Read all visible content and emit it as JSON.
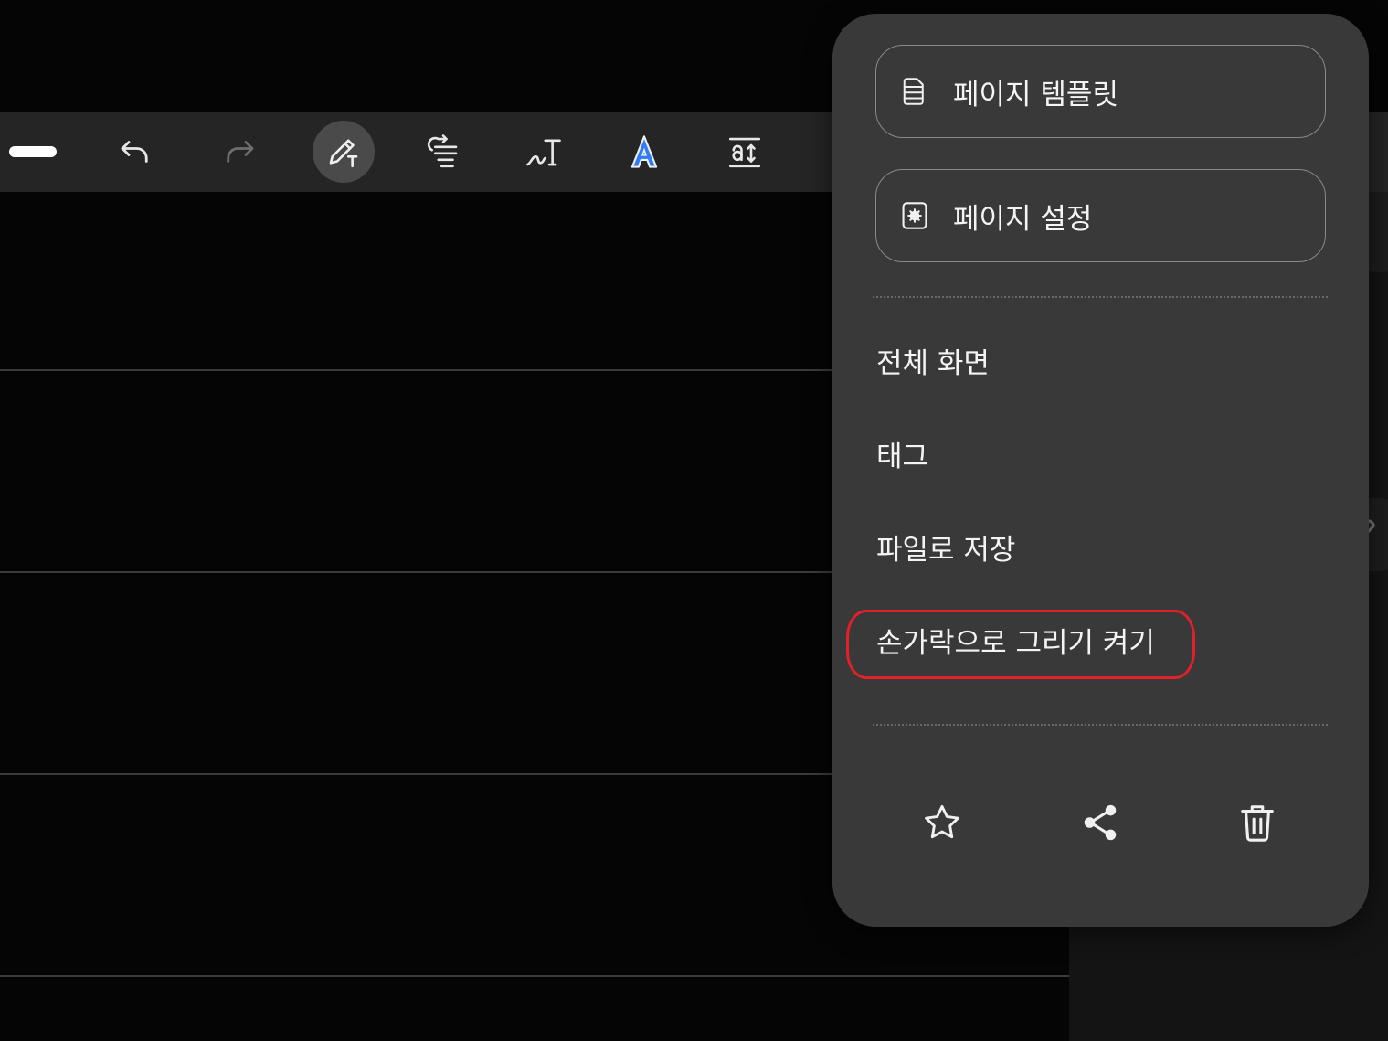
{
  "toolbar": {
    "tools": [
      {
        "name": "handle",
        "icon": "handle-bar-icon"
      },
      {
        "name": "undo",
        "icon": "undo-icon"
      },
      {
        "name": "redo",
        "icon": "redo-icon"
      },
      {
        "name": "pen",
        "icon": "pen-icon",
        "active": true
      },
      {
        "name": "text-align",
        "icon": "align-icon"
      },
      {
        "name": "handwriting-to-text",
        "icon": "handwriting-text-icon"
      },
      {
        "name": "text-style",
        "icon": "text-style-icon"
      },
      {
        "name": "text-size",
        "icon": "text-size-icon"
      }
    ]
  },
  "menu": {
    "page_template_label": "페이지 템플릿",
    "page_settings_label": "페이지 설정",
    "items": [
      {
        "label": "전체 화면"
      },
      {
        "label": "태그"
      },
      {
        "label": "파일로 저장"
      },
      {
        "label": "손가락으로 그리기 켜기",
        "highlighted": true
      }
    ],
    "actions": [
      {
        "icon": "star-icon"
      },
      {
        "icon": "share-icon"
      },
      {
        "icon": "trash-icon"
      }
    ]
  },
  "colors": {
    "background": "#050505",
    "toolbar": "#252525",
    "menu": "#393939",
    "highlight": "#e0202a",
    "accent_blue": "#2f7cf6"
  }
}
